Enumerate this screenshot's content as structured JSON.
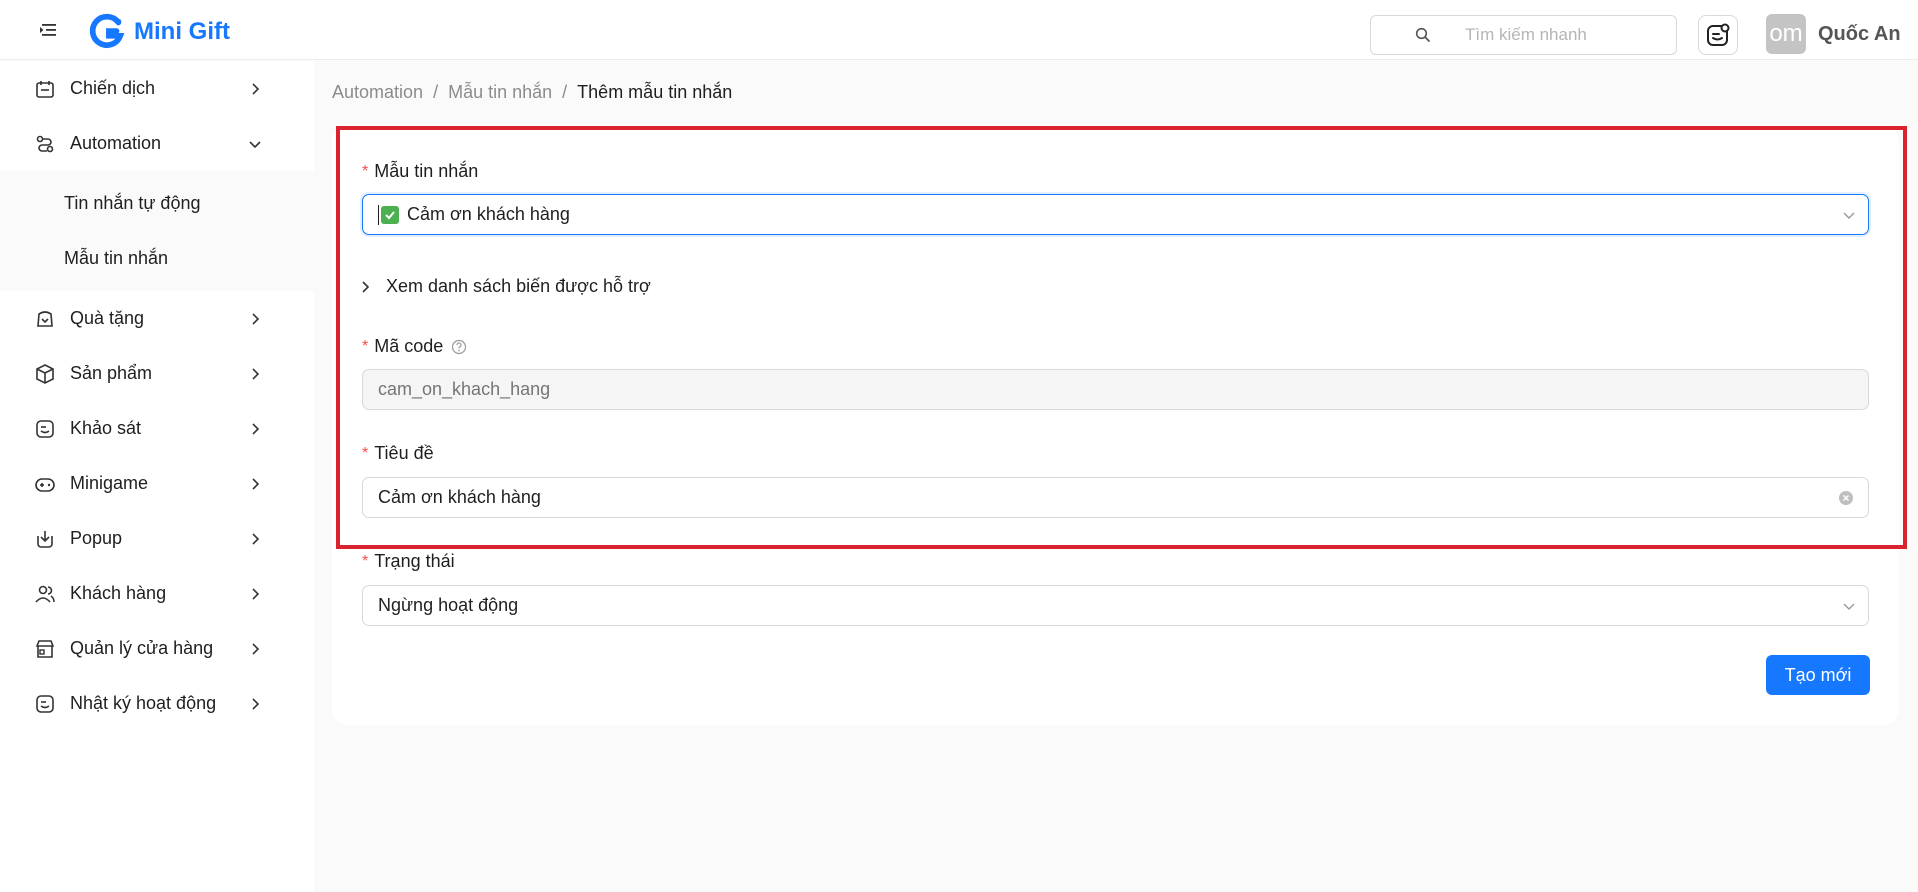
{
  "app": {
    "name": "Mini Gift",
    "brand_color": "#1677ff"
  },
  "header": {
    "search_placeholder": "Tìm kiếm nhanh",
    "avatar_text": "om",
    "user_name": "Quốc An"
  },
  "sidebar": {
    "items": [
      {
        "label": "Chiến dịch",
        "icon": "campaign-icon"
      },
      {
        "label": "Automation",
        "icon": "automation-icon",
        "expanded": true
      },
      {
        "label": "Quà tặng",
        "icon": "gift-icon"
      },
      {
        "label": "Sản phẩm",
        "icon": "product-box-icon"
      },
      {
        "label": "Khảo sát",
        "icon": "survey-icon"
      },
      {
        "label": "Minigame",
        "icon": "gamepad-icon"
      },
      {
        "label": "Popup",
        "icon": "popup-icon"
      },
      {
        "label": "Khách hàng",
        "icon": "users-icon"
      },
      {
        "label": "Quản lý cửa hàng",
        "icon": "store-icon"
      },
      {
        "label": "Nhật ký hoạt động",
        "icon": "log-icon"
      }
    ],
    "automation_sub": [
      {
        "label": "Tin nhắn tự động"
      },
      {
        "label": "Mẫu tin nhắn"
      }
    ]
  },
  "breadcrumb": {
    "items": [
      "Automation",
      "Mẫu tin nhắn",
      "Thêm mẫu tin nhắn"
    ],
    "separator": "/"
  },
  "form": {
    "template": {
      "label": "Mẫu tin nhắn",
      "value": "Cảm ơn khách hàng"
    },
    "variables_toggle": "Xem danh sách biến được hỗ trợ",
    "code": {
      "label": "Mã code",
      "placeholder": "cam_on_khach_hang"
    },
    "title": {
      "label": "Tiêu đề",
      "value": "Cảm ơn khách hàng"
    },
    "status": {
      "label": "Trạng thái",
      "value": "Ngừng hoạt động"
    },
    "submit_label": "Tạo mới",
    "required_mark": "*"
  },
  "colors": {
    "highlight_border": "#d9232e",
    "required": "#ff4d4f",
    "focus": "#1677ff"
  }
}
